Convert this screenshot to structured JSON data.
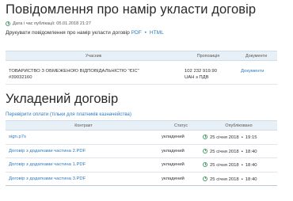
{
  "notice": {
    "title": "Повідомлення про намір укласти договір",
    "date_label": "Дата і час публікації:",
    "date_value": "05.01.2018 21:27",
    "print_label": "Друкувати повідомлення про намір укласти договір",
    "format_pdf": "PDF",
    "dot": "•",
    "format_html": "HTML"
  },
  "participants_table": {
    "headers": [
      "Учасник",
      "Пропозиція",
      "Документи"
    ],
    "rows": [
      {
        "name_line1": "ТОВАРИСТВО З ОБМЕЖЕНОЮ ВІДПОВІДАЛЬНІСТЮ \"ЄІС\"",
        "name_line2": "#39032160",
        "offer_line1": "102 232 919.90",
        "offer_line2": "UAH з ПДВ",
        "documents_link": "Документи"
      }
    ]
  },
  "contract": {
    "title": "Укладений договір",
    "recheck_link": "Перевірити оплати (тільки для платників казначейства)",
    "headers": [
      "Контракт",
      "Статус",
      "Опубліковано"
    ],
    "rows": [
      {
        "name": "sign.p7s",
        "status": "укладений",
        "date": "25 січня 2018",
        "sep": "•",
        "time": "19:15"
      },
      {
        "name": "Договір з додатками частина 2.PDF",
        "status": "укладений",
        "date": "25 січня 2018",
        "sep": "•",
        "time": "18:40"
      },
      {
        "name": "Договір з додатками частина 1.PDF",
        "status": "укладений",
        "date": "25 січня 2018",
        "sep": "•",
        "time": "18:40"
      },
      {
        "name": "Договір з додатками частина 3.PDF",
        "status": "укладений",
        "date": "25 січня 2018",
        "sep": "•",
        "time": "18:40"
      }
    ]
  },
  "colors": {
    "link": "#2f7bbf",
    "header_bg": "#e7f0f7",
    "clock": "#4d9a6c"
  }
}
